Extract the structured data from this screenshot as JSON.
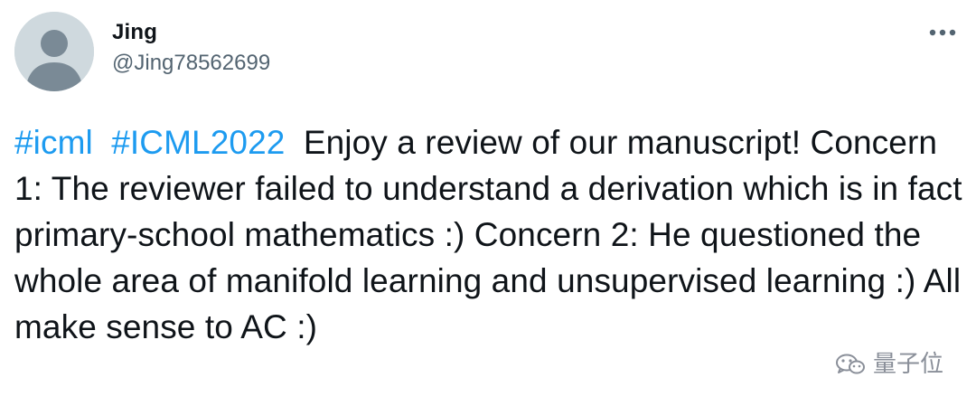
{
  "user": {
    "display_name": "Jing",
    "handle": "@Jing78562699",
    "avatar_icon": "default-avatar-icon"
  },
  "header": {
    "more_icon": "more-icon"
  },
  "tweet": {
    "hashtag_1": "#icml",
    "hashtag_2": "#ICML2022",
    "body": "Enjoy a review of our manuscript! Concern 1: The reviewer failed to understand a derivation which is in fact primary-school mathematics :) Concern 2: He questioned the whole area of manifold learning and unsupervised learning :) All make sense to AC :)"
  },
  "watermark": {
    "text": "量子位",
    "icon": "wechat-icon"
  },
  "colors": {
    "hashtag": "#1d9bf0",
    "text": "#0f1419",
    "secondary": "#536471",
    "avatar_bg": "#cfd9de",
    "avatar_fg": "#7a8a96"
  }
}
